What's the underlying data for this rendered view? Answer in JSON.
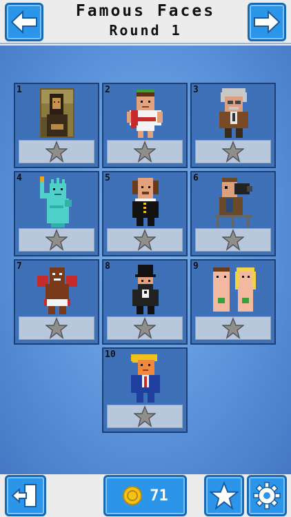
{
  "header": {
    "title_line1": "Famous Faces",
    "title_line2": "Round 1",
    "back_icon": "arrow-left-icon",
    "next_icon": "arrow-right-icon"
  },
  "levels": [
    {
      "number": "1",
      "subject": "mona-lisa"
    },
    {
      "number": "2",
      "subject": "caesar"
    },
    {
      "number": "3",
      "subject": "einstein"
    },
    {
      "number": "4",
      "subject": "statue-of-liberty"
    },
    {
      "number": "5",
      "subject": "shakespeare"
    },
    {
      "number": "6",
      "subject": "cameraman"
    },
    {
      "number": "7",
      "subject": "boxer"
    },
    {
      "number": "8",
      "subject": "abraham-lincoln"
    },
    {
      "number": "9",
      "subject": "adam-and-eve"
    },
    {
      "number": "10",
      "subject": "donald-trump"
    }
  ],
  "footer": {
    "exit_icon": "exit-door-icon",
    "coins": "71",
    "coin_icon": "coin-icon",
    "star_icon": "star-icon",
    "settings_icon": "gear-icon"
  },
  "colors": {
    "button_blue": "#2b95ea",
    "board_blue": "#5c93da",
    "star_grey": "#8f8f8f",
    "coin_gold": "#f6c21a"
  }
}
